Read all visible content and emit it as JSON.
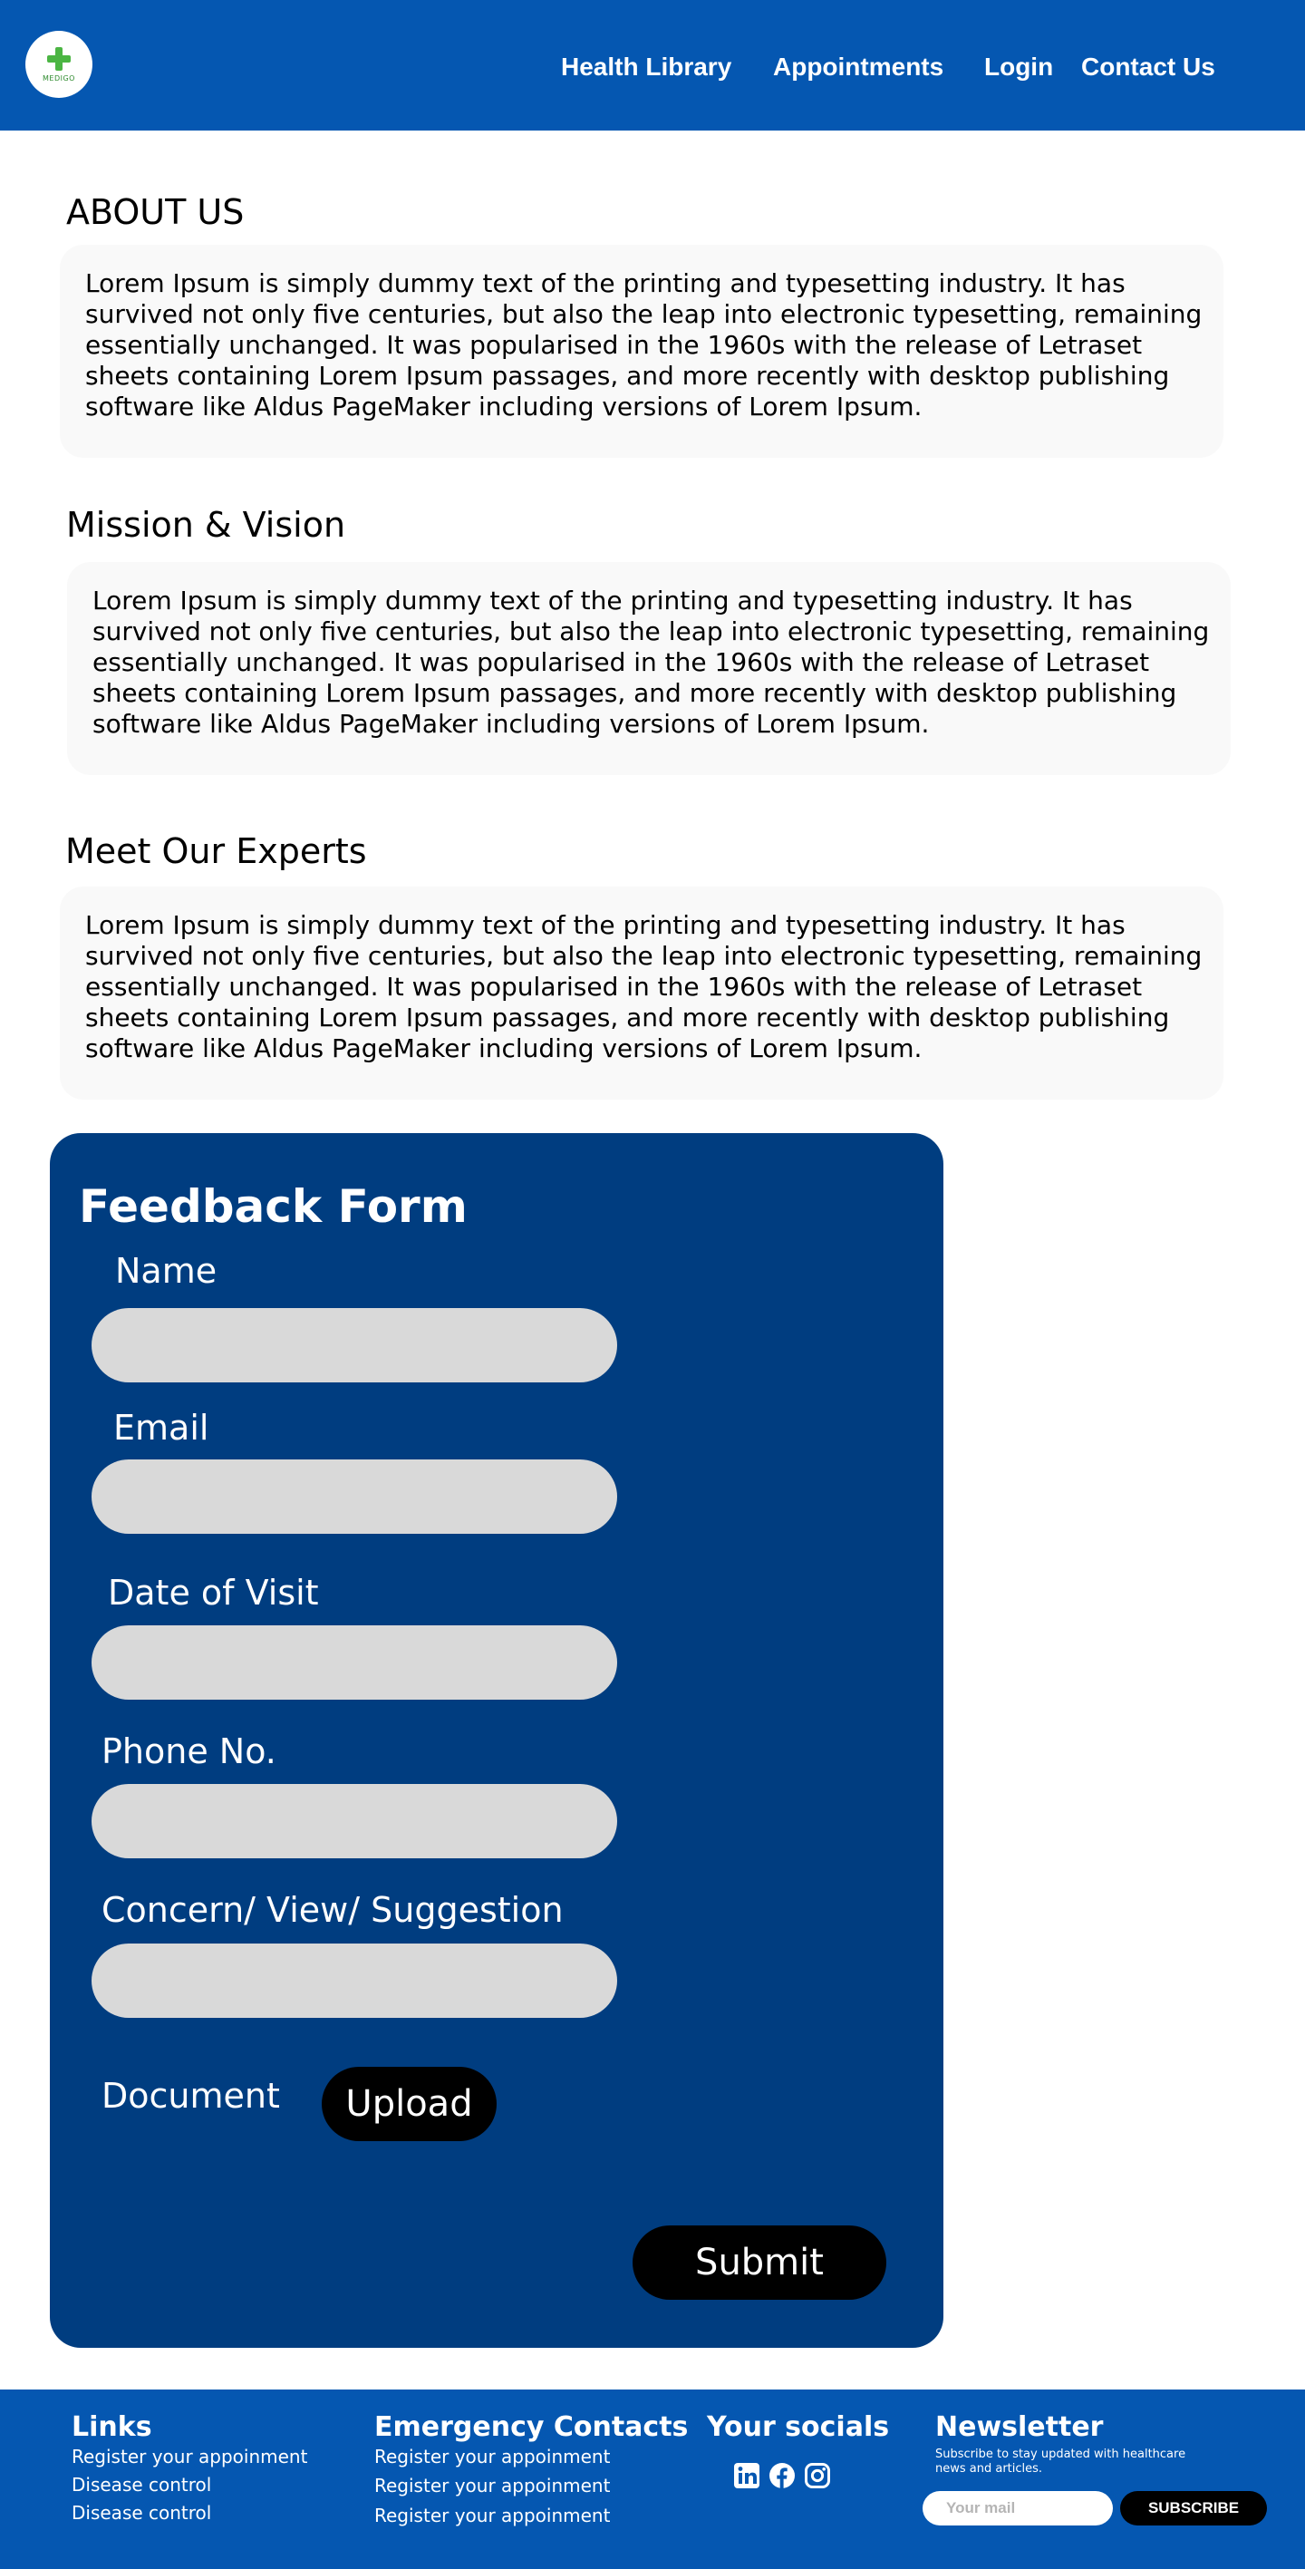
{
  "header": {
    "logo_text": "MEDIGO",
    "nav": {
      "health_library": "Health Library",
      "appointments": "Appointments",
      "login": "Login",
      "contact_us": "Contact Us"
    }
  },
  "sections": {
    "about": {
      "title": "ABOUT US",
      "text": "Lorem Ipsum is simply dummy text of the printing and typesetting industry. It has survived not only five centuries, but also the leap into electronic typesetting, remaining essentially unchanged. It was popularised in the 1960s with the release of Letraset sheets containing Lorem Ipsum passages, and more recently with desktop publishing software like Aldus PageMaker including versions of Lorem Ipsum."
    },
    "mission": {
      "title": "Mission & Vision",
      "text": "Lorem Ipsum is simply dummy text of the printing and typesetting industry. It has survived not only five centuries, but also the leap into electronic typesetting, remaining essentially unchanged. It was popularised in the 1960s with the release of Letraset sheets containing Lorem Ipsum passages, and more recently with desktop publishing software like Aldus PageMaker including versions of Lorem Ipsum."
    },
    "experts": {
      "title": "Meet Our Experts",
      "text": "Lorem Ipsum is simply dummy text of the printing and typesetting industry. It has survived not only five centuries, but also the leap into electronic typesetting, remaining essentially unchanged. It was popularised in the 1960s with the release of Letraset sheets containing Lorem Ipsum passages, and more recently with desktop publishing software like Aldus PageMaker including versions of Lorem Ipsum."
    }
  },
  "feedback_form": {
    "title": "Feedback Form",
    "labels": {
      "name": "Name",
      "email": "Email",
      "date_of_visit": "Date of Visit",
      "phone": "Phone No.",
      "concern": "Concern/ View/ Suggestion",
      "document": "Document"
    },
    "upload_label": "Upload",
    "submit_label": "Submit"
  },
  "footer": {
    "links": {
      "title": "Links",
      "items": [
        "Register your appoinment",
        "Disease control",
        "Disease control"
      ]
    },
    "emergency": {
      "title": "Emergency Contacts",
      "items": [
        "Register your appoinment",
        "Register your appoinment",
        "Register your appoinment"
      ]
    },
    "socials": {
      "title": "Your socials",
      "icons": [
        "linkedin-icon",
        "facebook-icon",
        "instagram-icon"
      ]
    },
    "newsletter": {
      "title": "Newsletter",
      "description": "Subscribe to stay updated with healthcare news and articles.",
      "placeholder": "Your mail",
      "button": "SUBSCRIBE"
    }
  },
  "colors": {
    "header_blue": "#0557b1",
    "form_navy": "#003d80",
    "input_gray": "#d9d9d9",
    "box_gray": "#f9f9f9"
  }
}
